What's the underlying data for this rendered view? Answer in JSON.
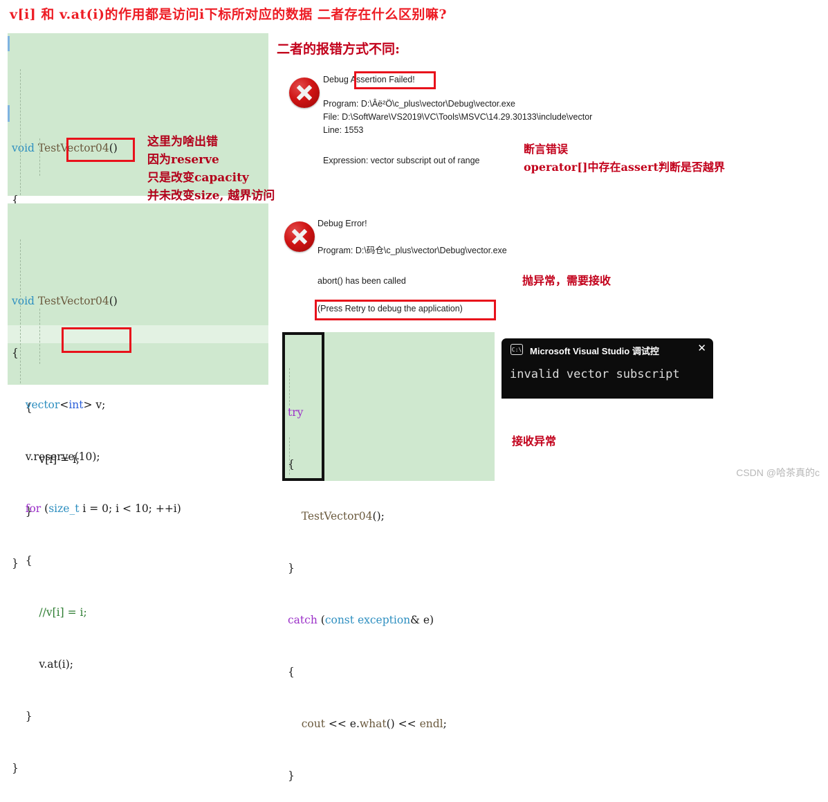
{
  "title": "v[i] 和 v.at(i)的作用都是访问i下标所对应的数据  二者存在什么区别嘛?",
  "code_blocks": {
    "block1": {
      "lines": [
        "void TestVector04()",
        "{",
        "    vector<int> v;",
        "    v.reserve(10);",
        "    for (size_t i = 0; i < 10; ++i)",
        "    {",
        "        v[i] = i;",
        "    }",
        "}"
      ]
    },
    "block2": {
      "lines": [
        "void TestVector04()",
        "{",
        "    vector<int> v;",
        "    v.reserve(10);",
        "    for (size_t i = 0; i < 10; ++i)",
        "    {",
        "        //v[i] = i;",
        "        v.at(i);",
        "    }",
        "}"
      ]
    },
    "block3": {
      "lines": [
        "try",
        "{",
        "    TestVector04();",
        "}",
        "catch (const exception& e)",
        "{",
        "    cout << e.what() << endl;",
        "}"
      ]
    }
  },
  "annotations": {
    "left_note": "这里为啥出错\n因为reserve\n只是改变capacity\n并未改变size, 越界访问",
    "heading": "二者的报错方式不同:",
    "assert_note": "断言错误\noperator[]中存在assert判断是否越界",
    "throw_note": "抛异常，需要接收",
    "catch_note": "接收异常"
  },
  "dialog_assertion": {
    "icon": "error-circle-icon",
    "title_prefix": "Debug ",
    "title_highlight": "Assertion Failed!",
    "program": "Program: D:\\Âë²Ö\\c_plus\\vector\\Debug\\vector.exe",
    "file": "File: D:\\SoftWare\\VS2019\\VC\\Tools\\MSVC\\14.29.30133\\include\\vector",
    "line": "Line: 1553",
    "expression": "Expression: vector subscript out of range"
  },
  "dialog_debug_error": {
    "icon": "error-circle-icon",
    "title": "Debug Error!",
    "program": "Program: D:\\码仓\\c_plus\\vector\\Debug\\vector.exe",
    "abort": "abort() has been called",
    "retry": "(Press Retry to debug the application)"
  },
  "console": {
    "app_icon": "terminal-icon",
    "icon_glyph": "C:\\",
    "title": "Microsoft Visual Studio 调试控",
    "close_label": "✕",
    "output": "invalid vector subscript"
  },
  "watermark": "CSDN @哈茶真的c",
  "colors": {
    "code_bg": "#cfe8cf",
    "annotation_red": "#c2001b",
    "title_red": "#ed1c24",
    "box_red": "#e8111b",
    "console_bg": "#0c0c0c"
  }
}
